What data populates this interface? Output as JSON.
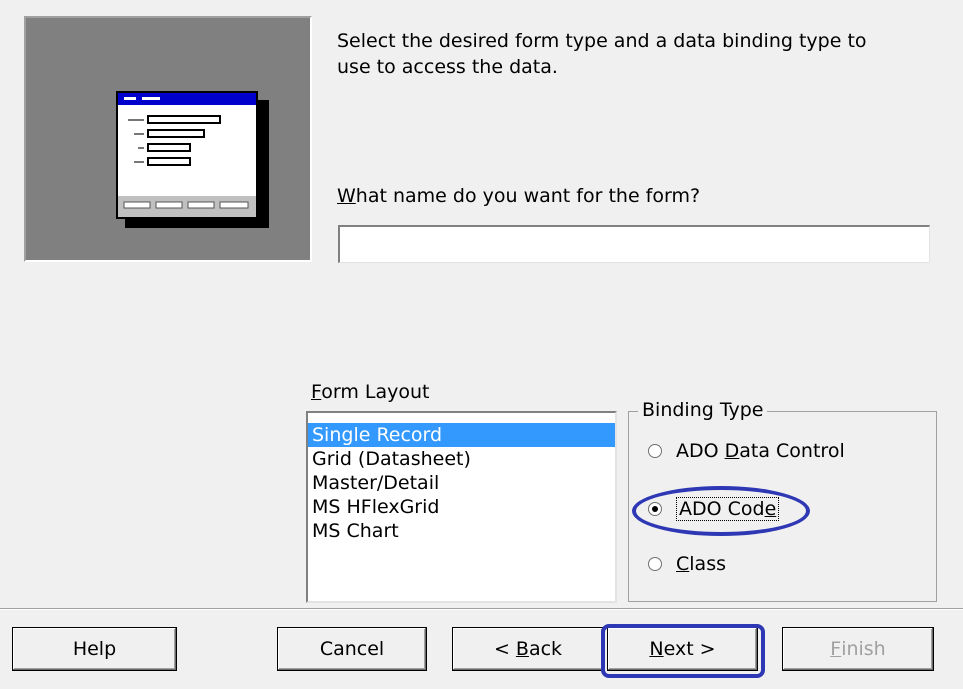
{
  "instructions": "Select the desired form type and a data binding type to use to access the data.",
  "form_name": {
    "label_accel": "W",
    "label_rest": "hat name do you want for the form?",
    "value": ""
  },
  "form_layout": {
    "label_accel": "F",
    "label_rest": "orm Layout",
    "items": [
      "Single Record",
      "Grid (Datasheet)",
      "Master/Detail",
      "MS HFlexGrid",
      "MS Chart"
    ],
    "selected_index": 0
  },
  "binding_type": {
    "legend": "Binding Type",
    "options": [
      {
        "pre": "ADO ",
        "accel": "D",
        "post": "ata Control",
        "checked": false
      },
      {
        "pre": "ADO Cod",
        "accel": "e",
        "post": "",
        "checked": true
      },
      {
        "pre": "",
        "accel": "C",
        "post": "lass",
        "checked": false
      }
    ]
  },
  "buttons": {
    "help": "Help",
    "cancel": "Cancel",
    "back_pre": "< ",
    "back_accel": "B",
    "back_post": "ack",
    "next_accel": "N",
    "next_post": "ext >",
    "finish_accel": "F",
    "finish_post": "inish"
  },
  "colors": {
    "annotation": "#2e38b5",
    "selection": "#3399ff",
    "dialog_bg": "#f0f0f0"
  }
}
